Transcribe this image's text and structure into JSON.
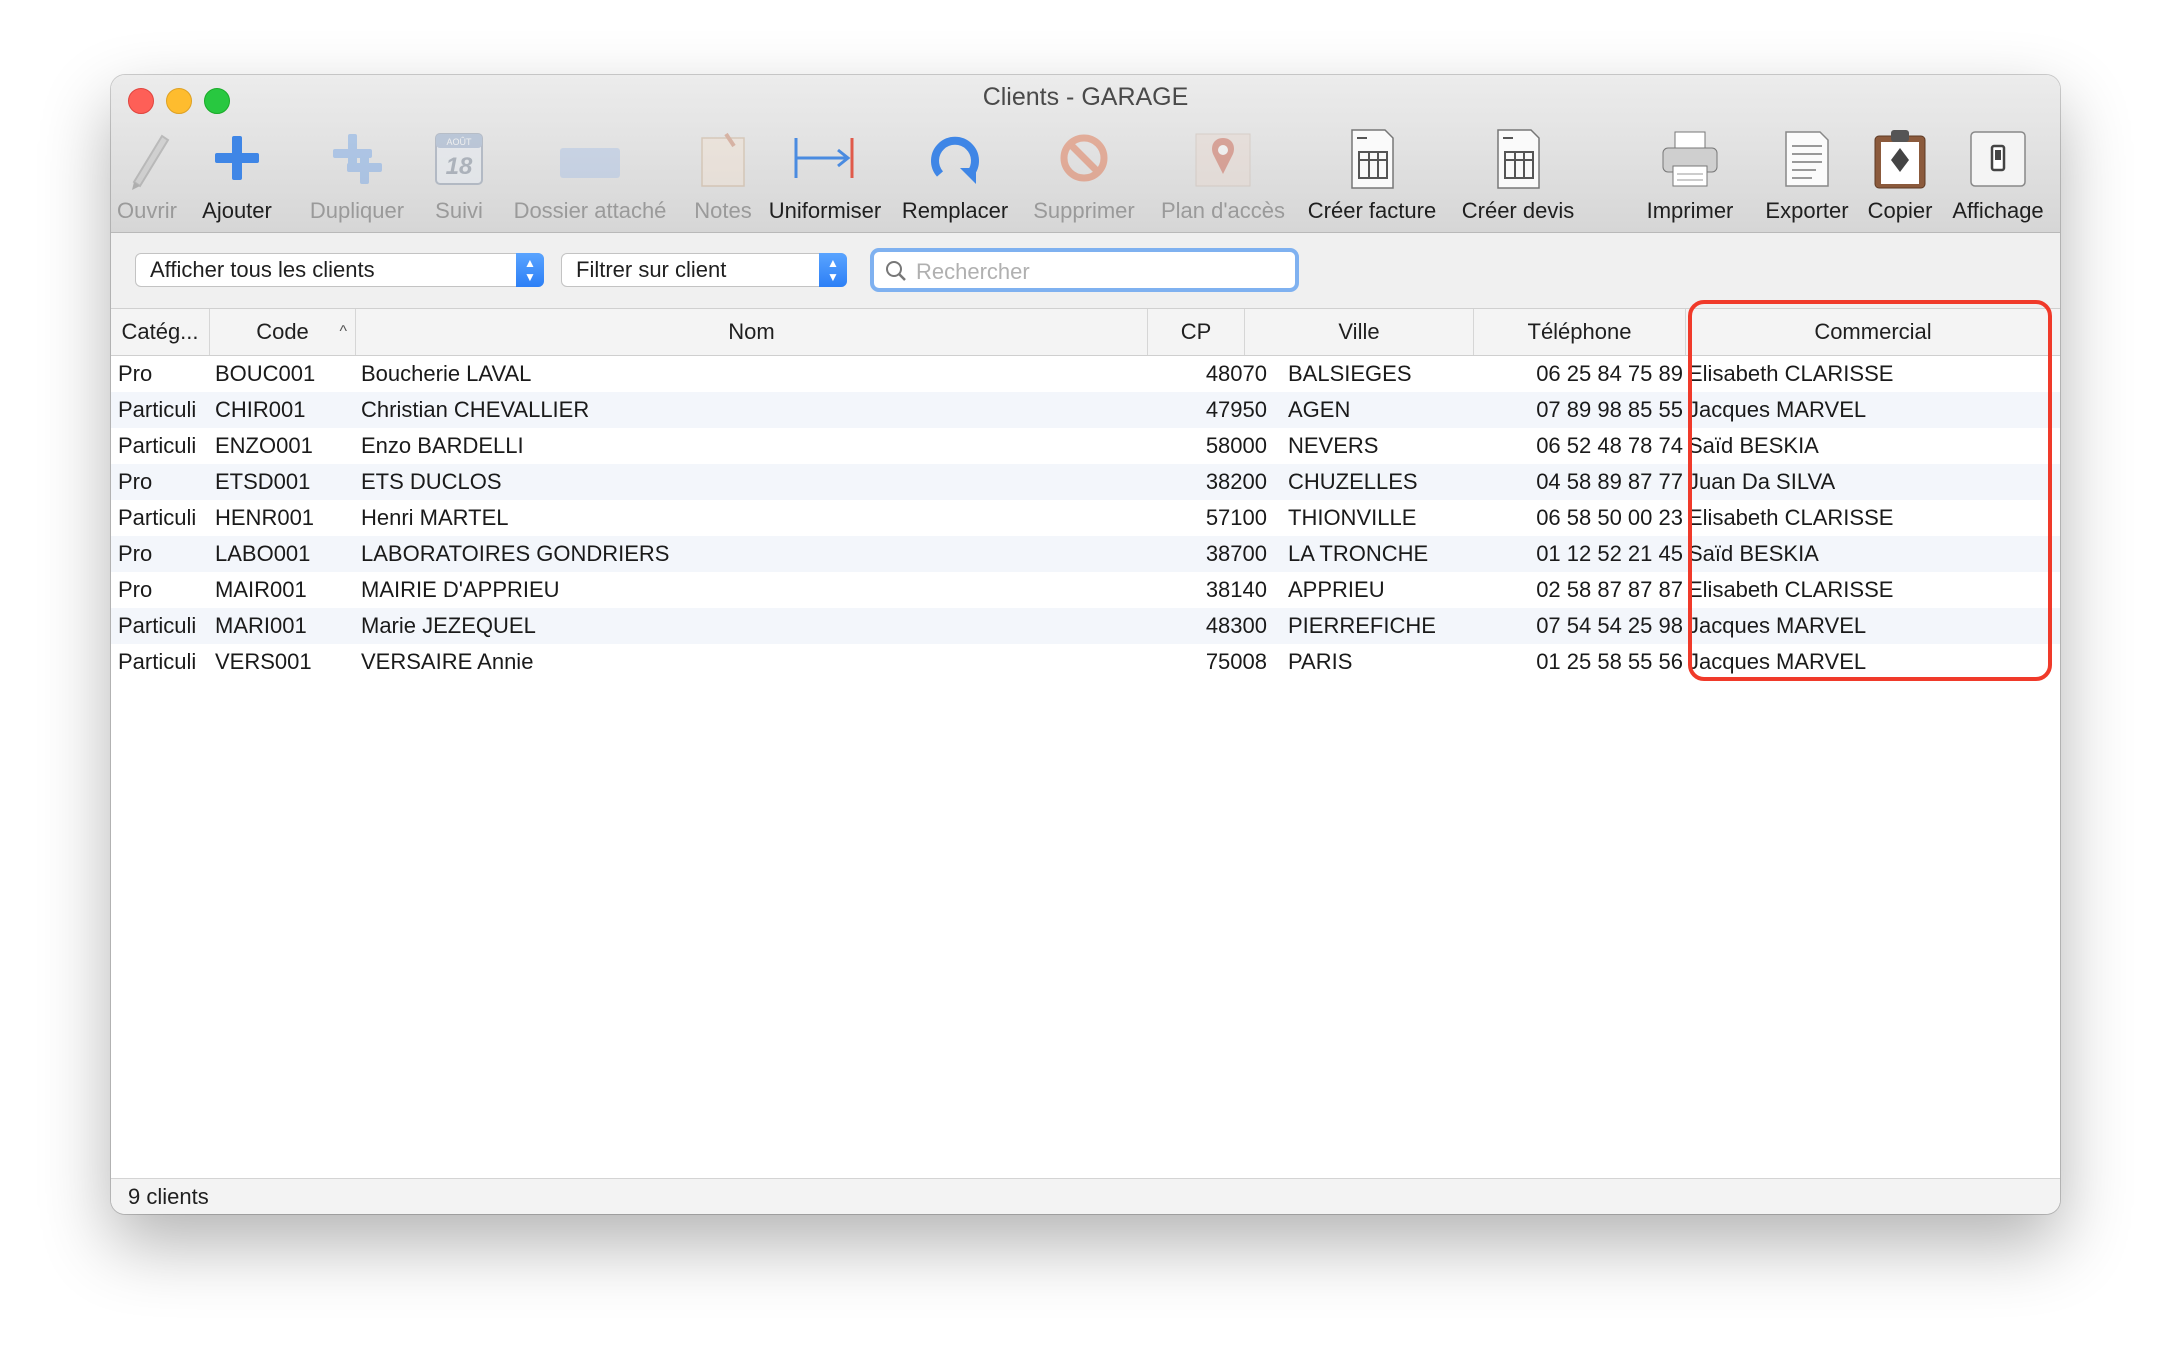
{
  "window": {
    "title": "Clients - GARAGE"
  },
  "toolbar": {
    "items": [
      {
        "label": "Ouvrir",
        "enabled": false,
        "icon": "pencil-icon"
      },
      {
        "label": "Ajouter",
        "enabled": true,
        "icon": "plus-icon"
      },
      {
        "label": "Dupliquer",
        "enabled": false,
        "icon": "duplicate-plus-icon"
      },
      {
        "label": "Suivi",
        "enabled": false,
        "icon": "calendar-icon",
        "calendar_month": "AOÛT",
        "calendar_day": "18"
      },
      {
        "label": "Dossier attaché",
        "enabled": false,
        "icon": "folder-icon"
      },
      {
        "label": "Notes",
        "enabled": false,
        "icon": "notes-icon"
      },
      {
        "label": "Uniformiser",
        "enabled": true,
        "icon": "arrow-to-bar-icon"
      },
      {
        "label": "Remplacer",
        "enabled": true,
        "icon": "replace-circle-arrow-icon"
      },
      {
        "label": "Supprimer",
        "enabled": false,
        "icon": "prohibited-icon"
      },
      {
        "label": "Plan d'accès",
        "enabled": false,
        "icon": "map-pin-icon"
      },
      {
        "label": "Créer facture",
        "enabled": true,
        "icon": "invoice-document-icon"
      },
      {
        "label": "Créer devis",
        "enabled": true,
        "icon": "quote-document-icon"
      },
      {
        "label": "Imprimer",
        "enabled": true,
        "icon": "printer-icon"
      },
      {
        "label": "Exporter",
        "enabled": true,
        "icon": "export-document-icon"
      },
      {
        "label": "Copier",
        "enabled": true,
        "icon": "clipboard-icon"
      },
      {
        "label": "Affichage",
        "enabled": true,
        "icon": "display-switch-icon"
      }
    ]
  },
  "filters": {
    "show_popup": "Afficher tous les clients",
    "filter_popup": "Filtrer sur client",
    "search_placeholder": "Rechercher"
  },
  "table": {
    "columns": [
      "Catég...",
      "Code",
      "Nom",
      "CP",
      "Ville",
      "Téléphone",
      "Commercial"
    ],
    "sorted_column": "Code",
    "rows": [
      {
        "cat": "Pro",
        "code": "BOUC001",
        "nom": "Boucherie LAVAL",
        "cp": "48070",
        "ville": "BALSIEGES",
        "tel": "06 25 84 75 89",
        "com": "Elisabeth CLARISSE"
      },
      {
        "cat": "Particuli",
        "code": "CHIR001",
        "nom": "Christian CHEVALLIER",
        "cp": "47950",
        "ville": "AGEN",
        "tel": "07 89 98 85 55",
        "com": "Jacques MARVEL"
      },
      {
        "cat": "Particuli",
        "code": "ENZO001",
        "nom": "Enzo BARDELLI",
        "cp": "58000",
        "ville": "NEVERS",
        "tel": "06 52 48 78 74",
        "com": "Saïd BESKIA"
      },
      {
        "cat": "Pro",
        "code": "ETSD001",
        "nom": "ETS DUCLOS",
        "cp": "38200",
        "ville": "CHUZELLES",
        "tel": "04 58 89 87 77",
        "com": "Juan Da SILVA"
      },
      {
        "cat": "Particuli",
        "code": "HENR001",
        "nom": "Henri MARTEL",
        "cp": "57100",
        "ville": "THIONVILLE",
        "tel": "06 58 50 00 23",
        "com": "Elisabeth CLARISSE"
      },
      {
        "cat": "Pro",
        "code": "LABO001",
        "nom": "LABORATOIRES GONDRIERS",
        "cp": "38700",
        "ville": "LA TRONCHE",
        "tel": "01 12 52 21 45",
        "com": "Saïd BESKIA"
      },
      {
        "cat": "Pro",
        "code": "MAIR001",
        "nom": "MAIRIE D'APPRIEU",
        "cp": "38140",
        "ville": "APPRIEU",
        "tel": "02 58 87 87 87",
        "com": "Elisabeth CLARISSE"
      },
      {
        "cat": "Particuli",
        "code": "MARI001",
        "nom": "Marie JEZEQUEL",
        "cp": "48300",
        "ville": "PIERREFICHE",
        "tel": "07 54 54 25 98",
        "com": "Jacques MARVEL"
      },
      {
        "cat": "Particuli",
        "code": "VERS001",
        "nom": "VERSAIRE Annie",
        "cp": "75008",
        "ville": "PARIS",
        "tel": "01 25 58 55 56",
        "com": "Jacques MARVEL"
      }
    ]
  },
  "status": {
    "count_text": "9 clients"
  },
  "colors": {
    "highlight": "#f03a2a",
    "accent": "#2c7ff6",
    "row_alt": "#f3f6fb"
  }
}
